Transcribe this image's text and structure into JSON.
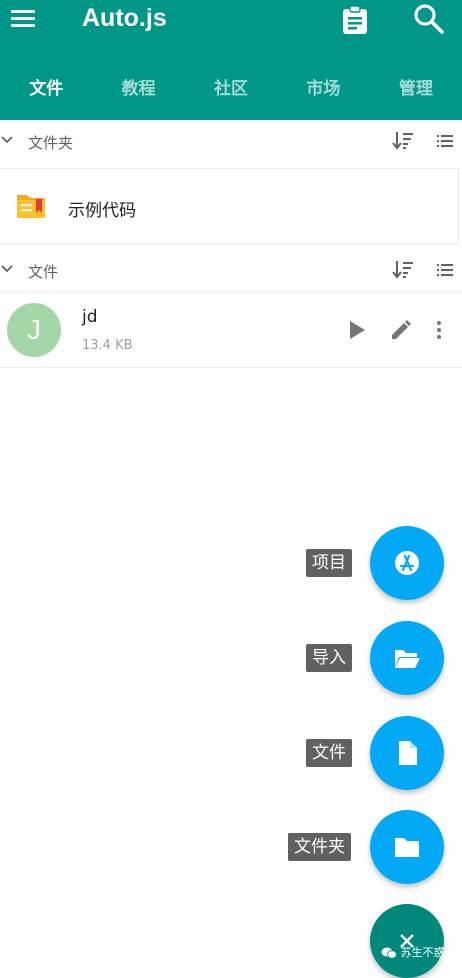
{
  "app": {
    "title": "Auto.js"
  },
  "header_icons": {
    "menu": "menu-icon",
    "clipboard": "clipboard-icon",
    "search": "search-icon"
  },
  "tabs": [
    {
      "label": "文件",
      "active": true
    },
    {
      "label": "教程",
      "active": false
    },
    {
      "label": "社区",
      "active": false
    },
    {
      "label": "市场",
      "active": false
    },
    {
      "label": "管理",
      "active": false
    }
  ],
  "folders_section": {
    "title": "文件夹",
    "items": [
      {
        "name": "示例代码"
      }
    ]
  },
  "files_section": {
    "title": "文件",
    "items": [
      {
        "avatar_letter": "J",
        "name": "jd",
        "size": "13.4 KB"
      }
    ]
  },
  "fab_menu": {
    "items": [
      {
        "label": "项目",
        "icon": "app-store-icon"
      },
      {
        "label": "导入",
        "icon": "folder-open-icon"
      },
      {
        "label": "文件",
        "icon": "file-icon"
      },
      {
        "label": "文件夹",
        "icon": "folder-icon"
      }
    ],
    "main_icon": "close-icon"
  },
  "watermark": {
    "text": "苏生不惑"
  },
  "colors": {
    "primary": "#009688",
    "fab": "#03a9f4",
    "fab_main": "#00897b",
    "avatar": "#a5d6a7",
    "label_bg": "#616161"
  }
}
